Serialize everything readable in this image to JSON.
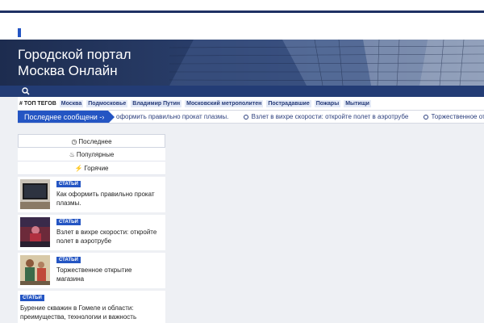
{
  "site": {
    "title_line1": "Городской портал",
    "title_line2": "Москва Онлайн"
  },
  "tags": {
    "lead_label": "ТОП ТЕГОВ",
    "items": [
      "Москва",
      "Подмосковье",
      "Владимир Путин",
      "Московский метрополитен",
      "Пострадавшие",
      "Пожары",
      "Мытищи"
    ]
  },
  "ticker": {
    "label": "Последнее сообщени",
    "items": [
      "оформить правильно прокат плазмы.",
      "Взлет в вихре скорости: откройте полет в аэротрубе",
      "Торжественное откр"
    ]
  },
  "widget": {
    "tabs": [
      "Последнее",
      "Популярные",
      "Горячие"
    ]
  },
  "posts": [
    {
      "badge": "СТАТЬИ",
      "title": "Как оформить правильно прокат плазмы."
    },
    {
      "badge": "СТАТЬИ",
      "title": "Взлет в вихре скорости: откройте полет в аэротрубе"
    },
    {
      "badge": "СТАТЬИ",
      "title": "Торжественное открытие магазина"
    },
    {
      "badge": "СТАТЬИ",
      "title": "Бурение скважин в Гомеле и области: преимущества, технологии и важность"
    }
  ],
  "colors": {
    "accent": "#2455c3",
    "nav": "#233c75"
  }
}
